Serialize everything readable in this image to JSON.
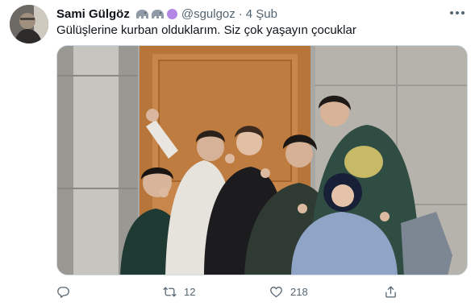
{
  "tweet": {
    "display_name": "Sami Gülgöz",
    "handle": "@sgulgoz",
    "separator": "·",
    "time": "4 Şub",
    "text": "Gülüşlerine kurban olduklarım. Siz çok yaşayın çocuklar",
    "name_emojis": [
      "elephant-icon",
      "elephant-icon",
      "purple-circle-icon"
    ]
  },
  "actions": {
    "reply_count": "",
    "retweet_count": "12",
    "like_count": "218",
    "share_count": ""
  },
  "colors": {
    "text_primary": "#0f1419",
    "text_secondary": "#536471",
    "border": "#cfd9de",
    "emoji_circle": "#b487e6"
  }
}
